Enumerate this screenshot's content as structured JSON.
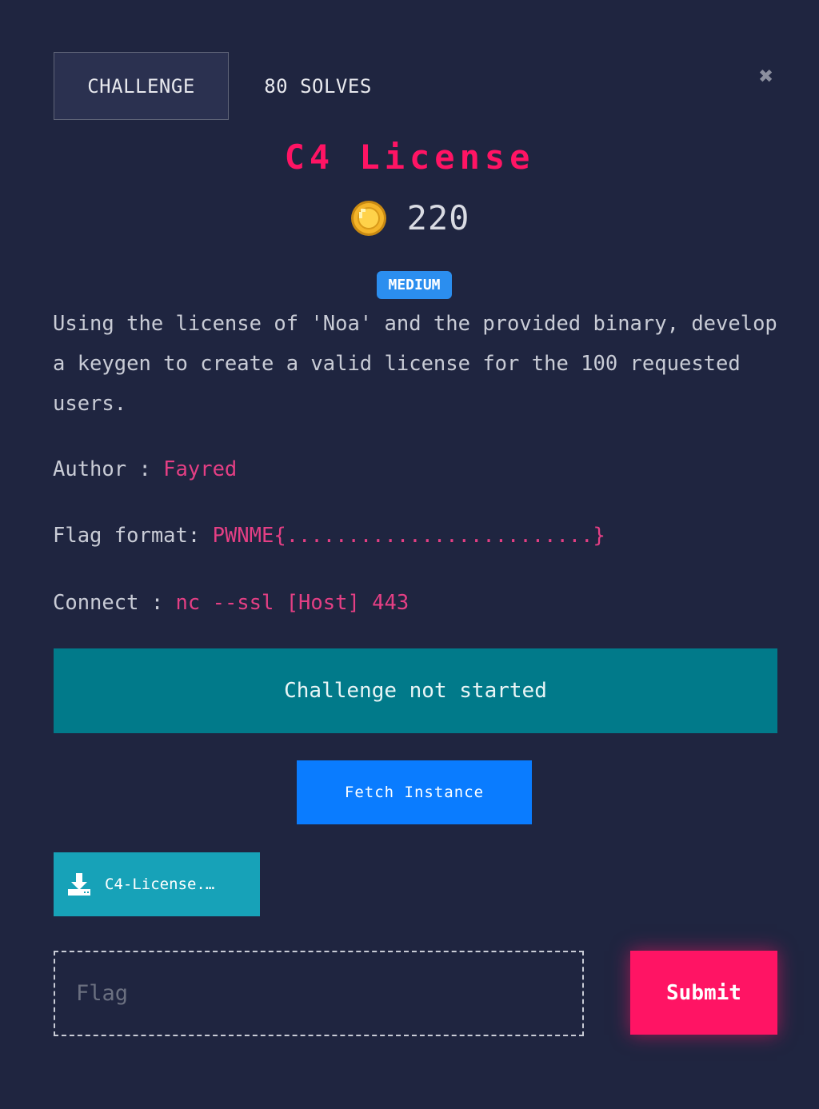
{
  "tabs": {
    "challenge_label": "CHALLENGE",
    "solves_label": "80 SOLVES"
  },
  "close_icon": "✖",
  "challenge": {
    "title": "C4 License",
    "points": "220",
    "difficulty": "MEDIUM",
    "description": "Using the license of 'Noa' and the provided binary, develop a keygen to create a valid license for the 100 requested users.",
    "author_label": "Author : ",
    "author": "Fayred",
    "flag_format_label": "Flag format: ",
    "flag_format": "PWNME{.........................}",
    "connect_label": "Connect : ",
    "connect": "nc --ssl [Host] 443"
  },
  "instance": {
    "status": "Challenge not started",
    "fetch_label": "Fetch Instance"
  },
  "file": {
    "label": "C4-License.…"
  },
  "submission": {
    "placeholder": "Flag",
    "submit_label": "Submit"
  },
  "icons": {
    "coin": "coin-icon",
    "download": "download-icon",
    "close": "close-icon"
  },
  "colors": {
    "background": "#1f2540",
    "title": "#ff1464",
    "accent": "#e43f84",
    "difficulty_badge": "#2b8eef",
    "status_banner": "#017a8a",
    "fetch_button": "#0a7cff",
    "file_button": "#17a2b8",
    "submit_button": "#ff1464"
  }
}
